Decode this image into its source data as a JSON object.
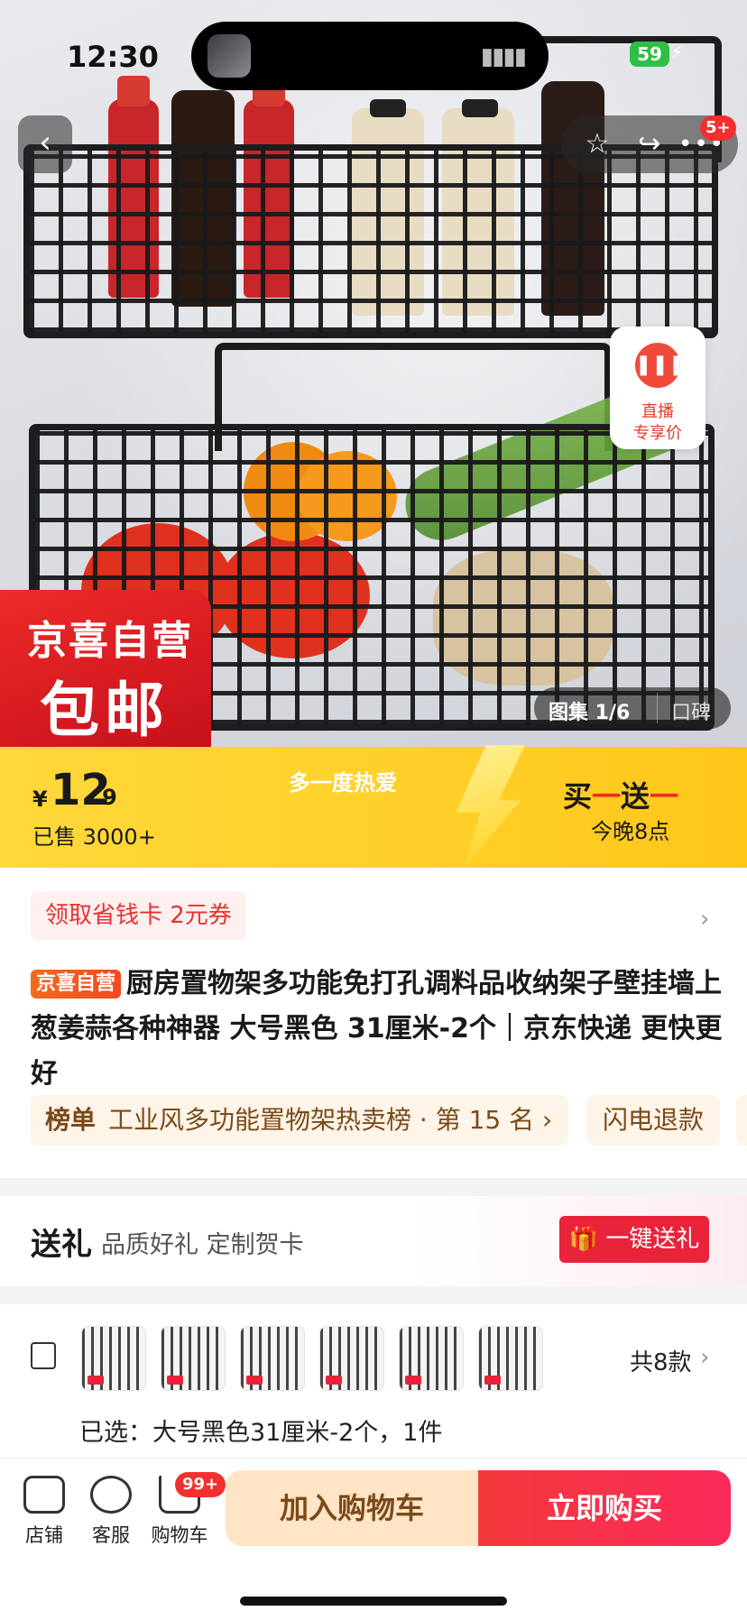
{
  "status_bar": {
    "time": "12:30",
    "battery": "59"
  },
  "hero": {
    "back_icon": "chevron-left-icon",
    "more_badge": "5+",
    "live": {
      "line1": "直播",
      "line2": "专享价"
    },
    "self_badge": {
      "line1": "京喜自营",
      "line2": "包邮"
    },
    "gallery": {
      "label": "图集 1/6",
      "review": "口碑"
    }
  },
  "price_bar": {
    "currency": "¥",
    "price_int": "12",
    "price_dec": ".9",
    "sold": "已售 3000+",
    "slogan": "多一度热爱",
    "promo_part1": "买",
    "promo_dash1": "一",
    "promo_part2": "送",
    "promo_dash2": "一",
    "promo_time": "今晚8点"
  },
  "coupon": {
    "label": "领取省钱卡 2元券"
  },
  "product": {
    "tag": "京喜自营",
    "title": "厨房置物架多功能免打孔调料品收纳架子壁挂墙上葱姜蒜各种神器 大号黑色 31厘米-2个｜京东快递 更快更好"
  },
  "ranking": {
    "key": "榜单",
    "value": "工业风多功能置物架热卖榜 · 第 15 名 ›",
    "refund": "闪电退款"
  },
  "gift": {
    "title": "送礼",
    "subtitle": "品质好礼 定制贺卡",
    "button": "一键送礼"
  },
  "variants": {
    "count": "共8款",
    "selected": "已选：大号黑色31厘米-2个，1件",
    "thumbs": [
      "t1",
      "t2",
      "t3",
      "t4",
      "t5",
      "t6"
    ]
  },
  "bottom_bar": {
    "store": "店铺",
    "service": "客服",
    "cart": "购物车",
    "cart_badge": "99+",
    "add_to_cart": "加入购物车",
    "buy_now": "立即购买"
  },
  "colors": {
    "accent_red": "#e8233a",
    "price_yellow": "#ffd02a",
    "warm_tan": "#fff4e8"
  }
}
